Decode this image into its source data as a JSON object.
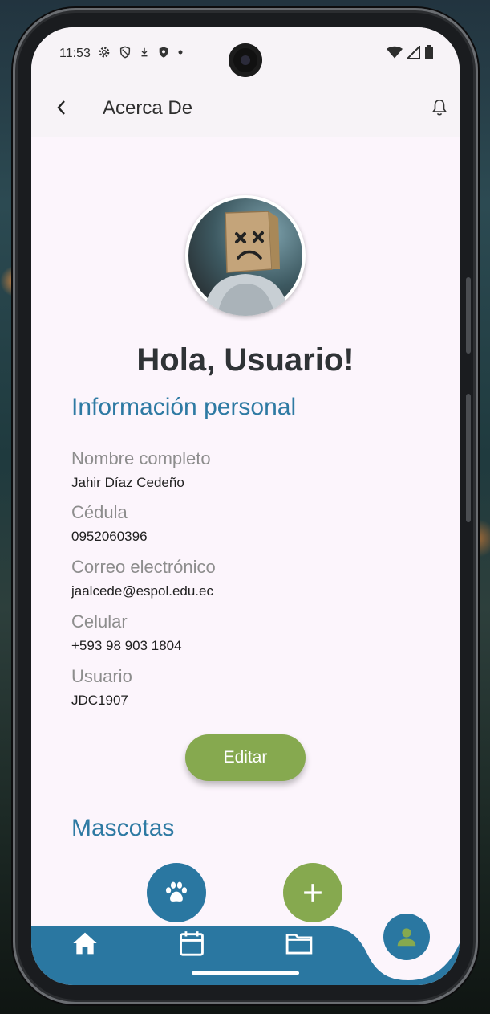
{
  "status_bar": {
    "time": "11:53"
  },
  "app_bar": {
    "title": "Acerca De"
  },
  "profile": {
    "greeting": "Hola, Usuario!"
  },
  "personal_info": {
    "section_title": "Información personal",
    "fields": [
      {
        "label": "Nombre completo",
        "value": "Jahir Díaz Cedeño"
      },
      {
        "label": "Cédula",
        "value": "0952060396"
      },
      {
        "label": "Correo electrónico",
        "value": "jaalcede@espol.edu.ec"
      },
      {
        "label": "Celular",
        "value": "+593 98 903 1804"
      },
      {
        "label": "Usuario",
        "value": "JDC1907"
      }
    ],
    "edit_label": "Editar"
  },
  "pets": {
    "section_title": "Mascotas"
  },
  "colors": {
    "primary_blue": "#2a77a1",
    "accent_green": "#86a94f",
    "background": "#fcf5fc",
    "title_blue": "#2e7aa3"
  },
  "icons": {
    "back": "chevron-left-icon",
    "bell": "bell-icon",
    "paw": "paw-icon",
    "add": "plus-icon",
    "home": "home-icon",
    "calendar": "calendar-icon",
    "folder": "folder-icon",
    "profile": "person-icon"
  }
}
